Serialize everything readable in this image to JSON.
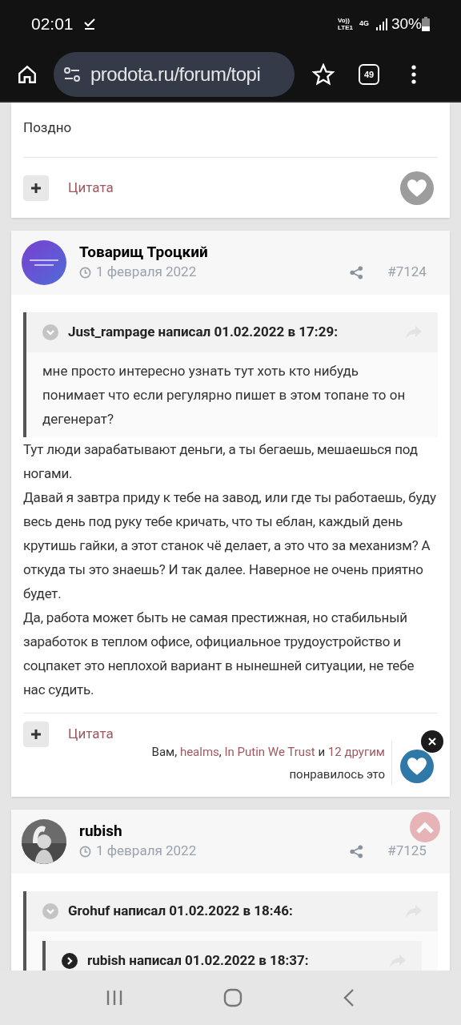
{
  "status_bar": {
    "time": "02:01",
    "volte": "Vo))",
    "lte": "LTE1",
    "network": "4G",
    "battery": "30%"
  },
  "browser": {
    "url": "prodota.ru/forum/topi",
    "tab_count": "49"
  },
  "posts": [
    {
      "kind": "tail",
      "paragraphs": [
        "Поздно"
      ],
      "quote_label": "Цитата",
      "liked": false
    },
    {
      "kind": "full",
      "author": "Товарищ Троцкий",
      "date": "1 февраля 2022",
      "number": "#7124",
      "quote": {
        "expanded": true,
        "header": "Just_rampage написал 01.02.2022 в 17:29:",
        "body": "мне просто интересно узнать тут хоть кто нибудь понимает что если регулярно пишет в этом топане то он дегенерат?"
      },
      "paragraphs": [
        "Тут люди зарабатывают деньги, а ты бегаешь, мешаешься под ногами.",
        "Давай я завтра приду к тебе на завод, или где ты работаешь, буду весь день под руку тебе кричать, что ты еблан, каждый день крутишь гайки, а этот станок чё делает, а это что за механизм? А откуда ты это знаешь? И так далее. Наверное не очень приятно будет.",
        "Да, работа может быть не самая престижная, но стабильный заработок в теплом офисе, официальное трудоустройство и соцпакет это неплохой вариант в нынешней ситуации, не тебе нас судить."
      ],
      "quote_label": "Цитата",
      "liked": true,
      "likes": [
        {
          "text": "Вам, ",
          "kind": "plain"
        },
        {
          "text": "healms",
          "kind": "link"
        },
        {
          "text": ", ",
          "kind": "plain"
        },
        {
          "text": "In Putin We Trust",
          "kind": "link"
        },
        {
          "text": " и ",
          "kind": "plain"
        },
        {
          "text": "12 другим",
          "kind": "link"
        }
      ],
      "likes_tail": "понравилось это"
    },
    {
      "kind": "head",
      "author": "rubish",
      "date": "1 февраля 2022",
      "number": "#7125",
      "quote": {
        "expanded": true,
        "header": "Grohuf написал 01.02.2022 в 18:46:",
        "nested": {
          "expanded": false,
          "header": "rubish написал 01.02.2022 в 18:37:"
        }
      }
    }
  ]
}
